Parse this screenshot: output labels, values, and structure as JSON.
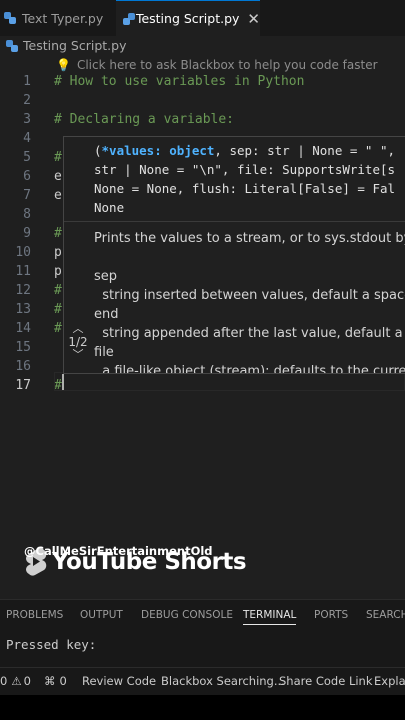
{
  "tabs": [
    {
      "label": "Text Typer.py",
      "icon": "python-file-icon"
    },
    {
      "label": "Testing Script.py",
      "icon": "python-file-icon",
      "close": "✕"
    }
  ],
  "breadcrumb": "Testing Script.py",
  "hint": "Click here to ask Blackbox to help you code faster",
  "code_lines": [
    {
      "n": "1",
      "text": "# How to use variables in Python"
    },
    {
      "n": "2",
      "text": ""
    },
    {
      "n": "3",
      "text": "# Declaring a variable:"
    },
    {
      "n": "4",
      "text": ""
    },
    {
      "n": "5",
      "text": "#"
    },
    {
      "n": "6",
      "text": "e"
    },
    {
      "n": "7",
      "text": "e"
    },
    {
      "n": "8",
      "text": ""
    },
    {
      "n": "9",
      "text": "#"
    },
    {
      "n": "10",
      "text": "p"
    },
    {
      "n": "11",
      "text": "p"
    },
    {
      "n": "12",
      "text": "#"
    },
    {
      "n": "13",
      "text": "#"
    },
    {
      "n": "14",
      "text": "#"
    },
    {
      "n": "15",
      "text": ""
    },
    {
      "n": "16",
      "text": ""
    },
    {
      "n": "17",
      "text": "#"
    }
  ],
  "signature": {
    "open": "(",
    "highlight": "*values: object",
    "rest1": ", sep: str | None = \" \",",
    "line2": "str | None = \"\\n\", file: SupportsWrite[s",
    "line3": "None = None, flush: Literal[False] = Fal",
    "line4": "None"
  },
  "doc": {
    "summary": "Prints the values to a stream, or to sys.stdout by de",
    "p1": "sep",
    "p1d": "  string inserted between values, default a space.",
    "p2": "end",
    "p2d": "  string appended after the last value, default a new",
    "p3": "file",
    "p3d": "  a file-like object (stream); defaults to the current"
  },
  "overload": "1/2",
  "watermark": {
    "brand": "YouTube Shorts",
    "handle": "@CallMeSirEntertainmentOld"
  },
  "panel_tabs": [
    "PROBLEMS",
    "OUTPUT",
    "DEBUG CONSOLE",
    "TERMINAL",
    "PORTS",
    "SEARCH"
  ],
  "terminal_text": "Pressed key:",
  "status": {
    "errors": "0",
    "warnings": "0",
    "ports": "0",
    "review": "Review Code",
    "blackbox": "Blackbox Searching...",
    "share": "Share Code Link",
    "explain": "Explain"
  }
}
